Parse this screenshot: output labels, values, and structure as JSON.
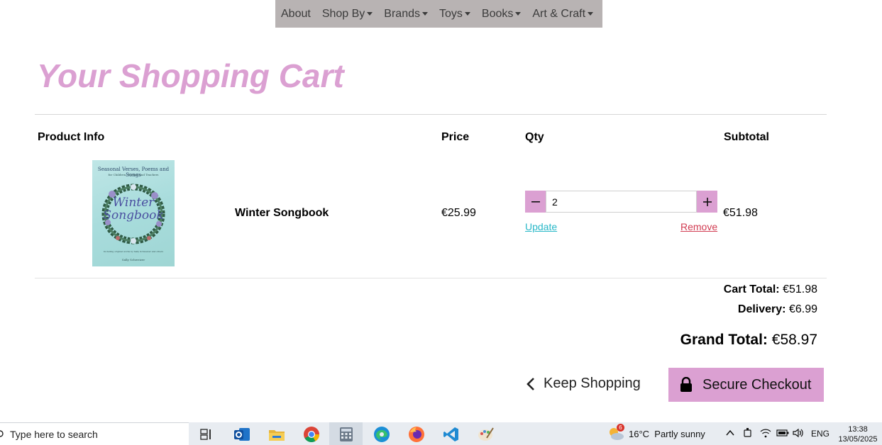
{
  "nav": {
    "items": [
      {
        "label": "About",
        "dropdown": false
      },
      {
        "label": "Shop By",
        "dropdown": true
      },
      {
        "label": "Brands",
        "dropdown": true
      },
      {
        "label": "Toys",
        "dropdown": true
      },
      {
        "label": "Books",
        "dropdown": true
      },
      {
        "label": "Art & Craft",
        "dropdown": true
      }
    ]
  },
  "page": {
    "title": "Your Shopping Cart"
  },
  "cart": {
    "headers": {
      "product": "Product Info",
      "price": "Price",
      "qty": "Qty",
      "subtotal": "Subtotal"
    },
    "item": {
      "name": "Winter Songbook",
      "price": "€25.99",
      "quantity": "2",
      "subtotal": "€51.98",
      "update_label": "Update",
      "remove_label": "Remove",
      "cover": {
        "top_text": "Seasonal Verses, Poems and Songs",
        "sub_text": "for Children, Parents and Teachers",
        "title_line1": "Winter",
        "title_line2": "Songbook",
        "foot_text": "Including original works by Sally Schweizer and others",
        "author": "Sally Schweizer"
      }
    },
    "totals": {
      "cart_total_label": "Cart Total:",
      "cart_total_value": "€51.98",
      "delivery_label": "Delivery:",
      "delivery_value": "€6.99",
      "grand_total_label": "Grand Total:",
      "grand_total_value": "€58.97"
    },
    "actions": {
      "keep_shopping": "Keep Shopping",
      "checkout": "Secure Checkout"
    }
  },
  "colors": {
    "accent": "#dba0d2",
    "nav_bg": "#b8b3b3",
    "update_link": "#29b8c8",
    "remove_link": "#d13c52"
  },
  "taskbar": {
    "search_placeholder": "Type here to search",
    "weather_badge": "6",
    "weather": "16°C  Partly sunny",
    "language": "ENG",
    "time": "13:38",
    "date": "13/05/2025",
    "apps": [
      "task-view-icon",
      "outlook-icon",
      "file-explorer-icon",
      "chrome-icon",
      "calculator-icon",
      "edge-icon",
      "firefox-icon",
      "vscode-icon",
      "paint-icon"
    ]
  }
}
